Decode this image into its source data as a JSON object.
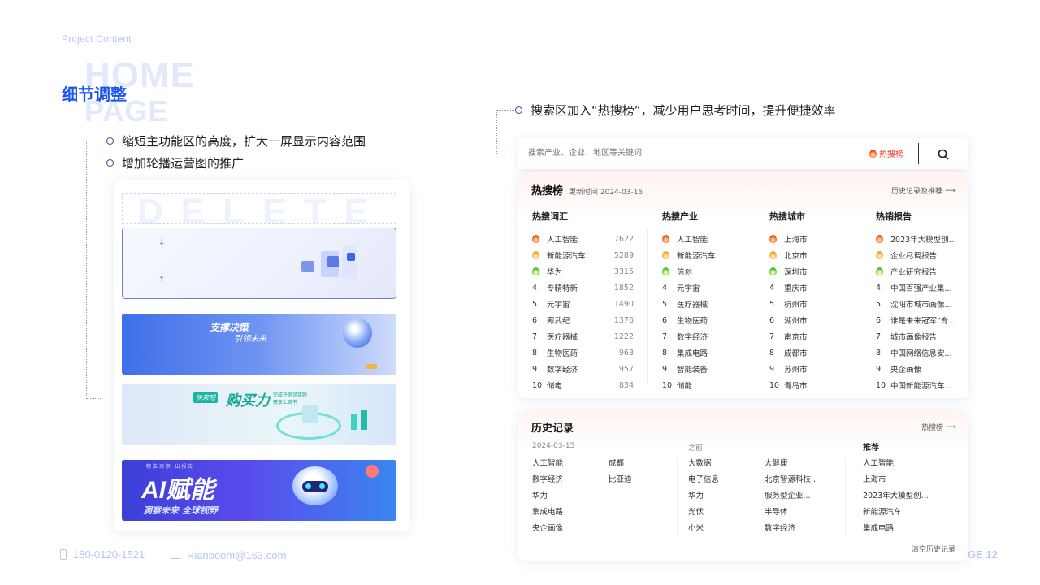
{
  "slide": {
    "project_label": "Project Content",
    "bg_word_1": "HOME",
    "bg_word_2": "PAGE",
    "section_title": "细节调整",
    "page_number": "GE 12"
  },
  "left_notes": [
    "缩短主功能区的高度，扩大一屏显示内容范围",
    "增加轮播运营图的推广"
  ],
  "right_note": "搜索区加入“热搜榜”，减少用户思考时间，提升便捷效率",
  "mock_left": {
    "delete_word": "DELETE",
    "banner2": {
      "line1": "支撑决策",
      "line2": "引领未来"
    },
    "banner3": {
      "tag": "快来吧",
      "title": "购买力",
      "sub1": "完成任务领奖励",
      "sub2": "豪享上奇书"
    },
    "banner4": {
      "title": "AI赋能",
      "sub": "洞察未来 全球视野",
      "top": "精 准 洞 察 · 出 报 告"
    }
  },
  "search": {
    "placeholder": "搜索产业、企业、地区等关键词",
    "hot_label": "热搜榜"
  },
  "hot_panel": {
    "title": "热搜榜",
    "updated": "更新时间 2024-03-15",
    "link": "历史记录及推荐",
    "columns": [
      {
        "header": "热搜词汇",
        "rows": [
          {
            "rank": "1",
            "name": "人工智能",
            "value": "7622"
          },
          {
            "rank": "2",
            "name": "新能源汽车",
            "value": "5289"
          },
          {
            "rank": "3",
            "name": "华为",
            "value": "3315"
          },
          {
            "rank": "4",
            "name": "专精特新",
            "value": "1852"
          },
          {
            "rank": "5",
            "name": "元宇宙",
            "value": "1490"
          },
          {
            "rank": "6",
            "name": "寒武纪",
            "value": "1376"
          },
          {
            "rank": "7",
            "name": "医疗器械",
            "value": "1222"
          },
          {
            "rank": "8",
            "name": "生物医药",
            "value": "963"
          },
          {
            "rank": "9",
            "name": "数字经济",
            "value": "957"
          },
          {
            "rank": "10",
            "name": "储电",
            "value": "834"
          }
        ]
      },
      {
        "header": "热搜产业",
        "rows": [
          {
            "rank": "1",
            "name": "人工智能"
          },
          {
            "rank": "2",
            "name": "新能源汽车"
          },
          {
            "rank": "3",
            "name": "信创"
          },
          {
            "rank": "4",
            "name": "元宇宙"
          },
          {
            "rank": "5",
            "name": "医疗器械"
          },
          {
            "rank": "6",
            "name": "生物医药"
          },
          {
            "rank": "7",
            "name": "数字经济"
          },
          {
            "rank": "8",
            "name": "集成电路"
          },
          {
            "rank": "9",
            "name": "智能装备"
          },
          {
            "rank": "10",
            "name": "储能"
          }
        ]
      },
      {
        "header": "热搜城市",
        "rows": [
          {
            "rank": "1",
            "name": "上海市"
          },
          {
            "rank": "2",
            "name": "北京市"
          },
          {
            "rank": "3",
            "name": "深圳市"
          },
          {
            "rank": "4",
            "name": "重庆市"
          },
          {
            "rank": "5",
            "name": "杭州市"
          },
          {
            "rank": "6",
            "name": "湖州市"
          },
          {
            "rank": "7",
            "name": "南京市"
          },
          {
            "rank": "8",
            "name": "成都市"
          },
          {
            "rank": "9",
            "name": "苏州市"
          },
          {
            "rank": "10",
            "name": "青岛市"
          }
        ]
      },
      {
        "header": "热销报告",
        "rows": [
          {
            "rank": "1",
            "name": "2023年大模型创..."
          },
          {
            "rank": "2",
            "name": "企业尽调报告"
          },
          {
            "rank": "3",
            "name": "产业研究报告"
          },
          {
            "rank": "4",
            "name": "中国百强产业集..."
          },
          {
            "rank": "5",
            "name": "沈阳市城市画像..."
          },
          {
            "rank": "6",
            "name": "谁是未来冠军”专..."
          },
          {
            "rank": "7",
            "name": "城市画像报告"
          },
          {
            "rank": "8",
            "name": "中国网络信息安..."
          },
          {
            "rank": "9",
            "name": "央企画像"
          },
          {
            "rank": "10",
            "name": "中国新能源汽车..."
          }
        ]
      }
    ]
  },
  "history_panel": {
    "title": "历史记录",
    "link": "热搜榜",
    "date_label": "2024-03-15",
    "before_label": "之前",
    "recommend_label": "推荐",
    "col1": [
      "人工智能",
      "数字经济",
      "华为",
      "集成电路",
      "央企画像"
    ],
    "col2": [
      "成都",
      "比亚迪"
    ],
    "col3": [
      "大数据",
      "电子信息",
      "华为",
      "光伏",
      "小米"
    ],
    "col4": [
      "大健康",
      "北京智源科技...",
      "服务型企业...",
      "半导体",
      "数字经济"
    ],
    "col5": [
      "人工智能",
      "上海市",
      "2023年大模型创...",
      "新能源汽车",
      "集成电路"
    ],
    "clear": "清空历史记录"
  },
  "footer": {
    "phone": "180-0120-1521",
    "email": "Rianboom@163.com"
  },
  "colors": {
    "accent": "#1a55f0",
    "hot": "#f04a26"
  }
}
